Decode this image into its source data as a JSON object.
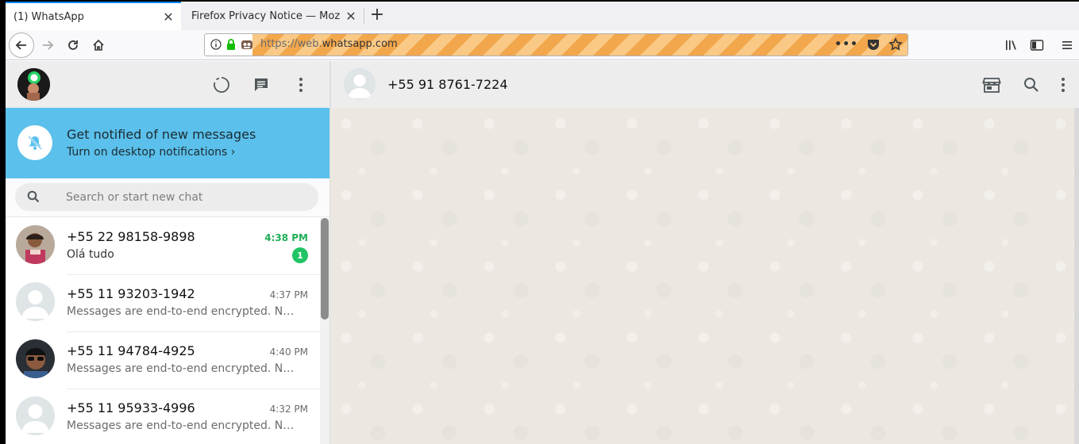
{
  "browser": {
    "tabs": [
      {
        "title": "(1) WhatsApp",
        "active": true
      },
      {
        "title": "Firefox Privacy Notice — Moz",
        "active": false
      }
    ],
    "url": {
      "prefix": "https://web.",
      "domain": "whatsapp.com"
    },
    "accent_color": "#0a84ff"
  },
  "whatsapp": {
    "sidebar_header": {
      "icons": [
        "status-icon",
        "new-chat-icon",
        "menu-icon"
      ]
    },
    "notification_banner": {
      "title": "Get notified of new messages",
      "subtitle": "Turn on desktop notifications ›",
      "color": "#5bc0eb"
    },
    "search": {
      "placeholder": "Search or start new chat",
      "value": ""
    },
    "chats": [
      {
        "name": "+55 22 98158-9898",
        "time": "4:38 PM",
        "message": "Olá tudo",
        "unread": "1",
        "has_photo": true
      },
      {
        "name": "+55 11 93203-1942",
        "time": "4:37 PM",
        "message": "Messages are end-to-end encrypted. No one outside of this chat, not even WhatsApp, can read or listen to them.",
        "unread": "",
        "has_photo": false
      },
      {
        "name": "+55 11 94784-4925",
        "time": "4:40 PM",
        "message": "Messages are end-to-end encrypted. No one outside of this chat, not even WhatsApp, can read or listen to them.",
        "unread": "",
        "has_photo": true
      },
      {
        "name": "+55 11 95933-4996",
        "time": "4:32 PM",
        "message": "Messages are end-to-end encrypted. No one outside of this chat, not even WhatsApp, can read or listen to them.",
        "unread": "",
        "has_photo": false
      }
    ],
    "conversation": {
      "contact_name": "+55 91 8761-7224",
      "icons": [
        "catalog-icon",
        "search-icon",
        "menu-icon"
      ]
    },
    "colors": {
      "unread_green": "#1fc463",
      "header_bg": "#ededed",
      "chat_bg": "#ece8e1"
    }
  }
}
